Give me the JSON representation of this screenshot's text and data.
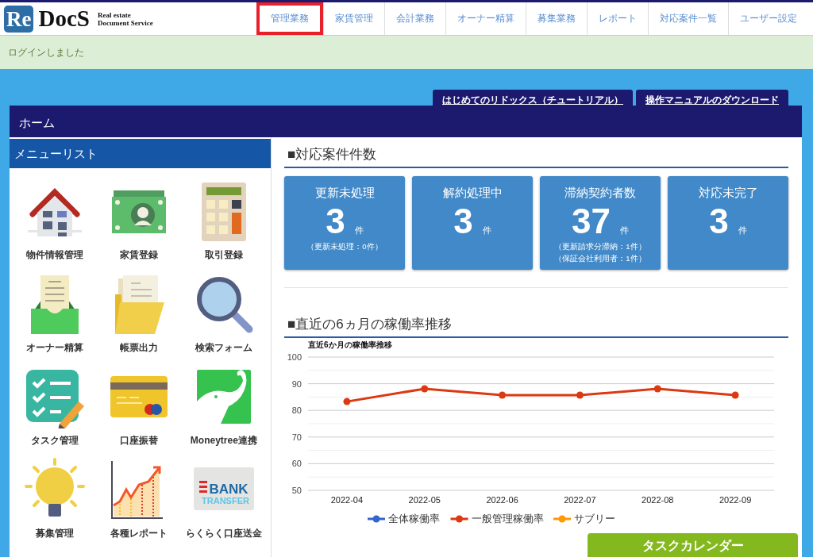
{
  "header": {
    "logo": {
      "mark": "Re",
      "name": "DocS",
      "tagline": [
        "Real estate",
        "Document Service"
      ]
    },
    "nav": [
      {
        "label": "管理業務",
        "selected": true
      },
      {
        "label": "家賃管理",
        "selected": false
      },
      {
        "label": "会計業務",
        "selected": false
      },
      {
        "label": "オーナー精算",
        "selected": false
      },
      {
        "label": "募集業務",
        "selected": false
      },
      {
        "label": "レポート",
        "selected": false
      },
      {
        "label": "対応案件一覧",
        "selected": false
      },
      {
        "label": "ユーザー設定",
        "selected": false
      }
    ]
  },
  "notice": {
    "message": "ログインしました"
  },
  "links": [
    "はじめてのリドックス（チュートリアル）",
    "操作マニュアルのダウンロード"
  ],
  "home": {
    "title": "ホーム"
  },
  "menu": {
    "title": "メニューリスト",
    "items": [
      {
        "label": "物件情報管理"
      },
      {
        "label": "家賃登録"
      },
      {
        "label": "取引登録"
      },
      {
        "label": "オーナー精算"
      },
      {
        "label": "帳票出力"
      },
      {
        "label": "検索フォーム"
      },
      {
        "label": "タスク管理"
      },
      {
        "label": "口座振替"
      },
      {
        "label": "Moneytree連携"
      },
      {
        "label": "募集管理"
      },
      {
        "label": "各種レポート"
      },
      {
        "label": "らくらく口座送金"
      }
    ],
    "transfer_icon_text": [
      "BANK",
      "TRANSFER"
    ]
  },
  "case_counts": {
    "heading": "■対応案件件数",
    "cards": [
      {
        "title": "更新未処理",
        "count": "3",
        "unit": "件",
        "notes": [
          "（更新未処理：0件）"
        ]
      },
      {
        "title": "解約処理中",
        "count": "3",
        "unit": "件"
      },
      {
        "title": "滞納契約者数",
        "count": "37",
        "unit": "件",
        "notes": [
          "（更新請求分滞納：1件）",
          "（保証会社利用者：1件）"
        ]
      },
      {
        "title": "対応未完了",
        "count": "3",
        "unit": "件"
      }
    ]
  },
  "utilization": {
    "heading": "■直近の6ヵ月の稼働率推移",
    "chart_data": {
      "type": "line",
      "title": "直近6か月の稼働率推移",
      "categories": [
        "2022-04",
        "2022-05",
        "2022-06",
        "2022-07",
        "2022-08",
        "2022-09"
      ],
      "ylim": [
        50,
        100
      ],
      "grid": true,
      "yticks": [
        50,
        60,
        70,
        80,
        90,
        100
      ],
      "series": [
        {
          "name": "全体稼働率",
          "color": "#3366cc",
          "values": [
            null,
            null,
            null,
            null,
            null,
            null
          ]
        },
        {
          "name": "一般管理稼働率",
          "color": "#dc3912",
          "marker": true,
          "values": [
            83.3,
            88.1,
            85.7,
            85.7,
            88.1,
            85.7
          ]
        },
        {
          "name": "サブリー",
          "color": "#ff9900",
          "values": [
            null,
            null,
            null,
            null,
            null,
            null
          ]
        }
      ]
    }
  },
  "task_calendar_button": "タスクカレンダー"
}
